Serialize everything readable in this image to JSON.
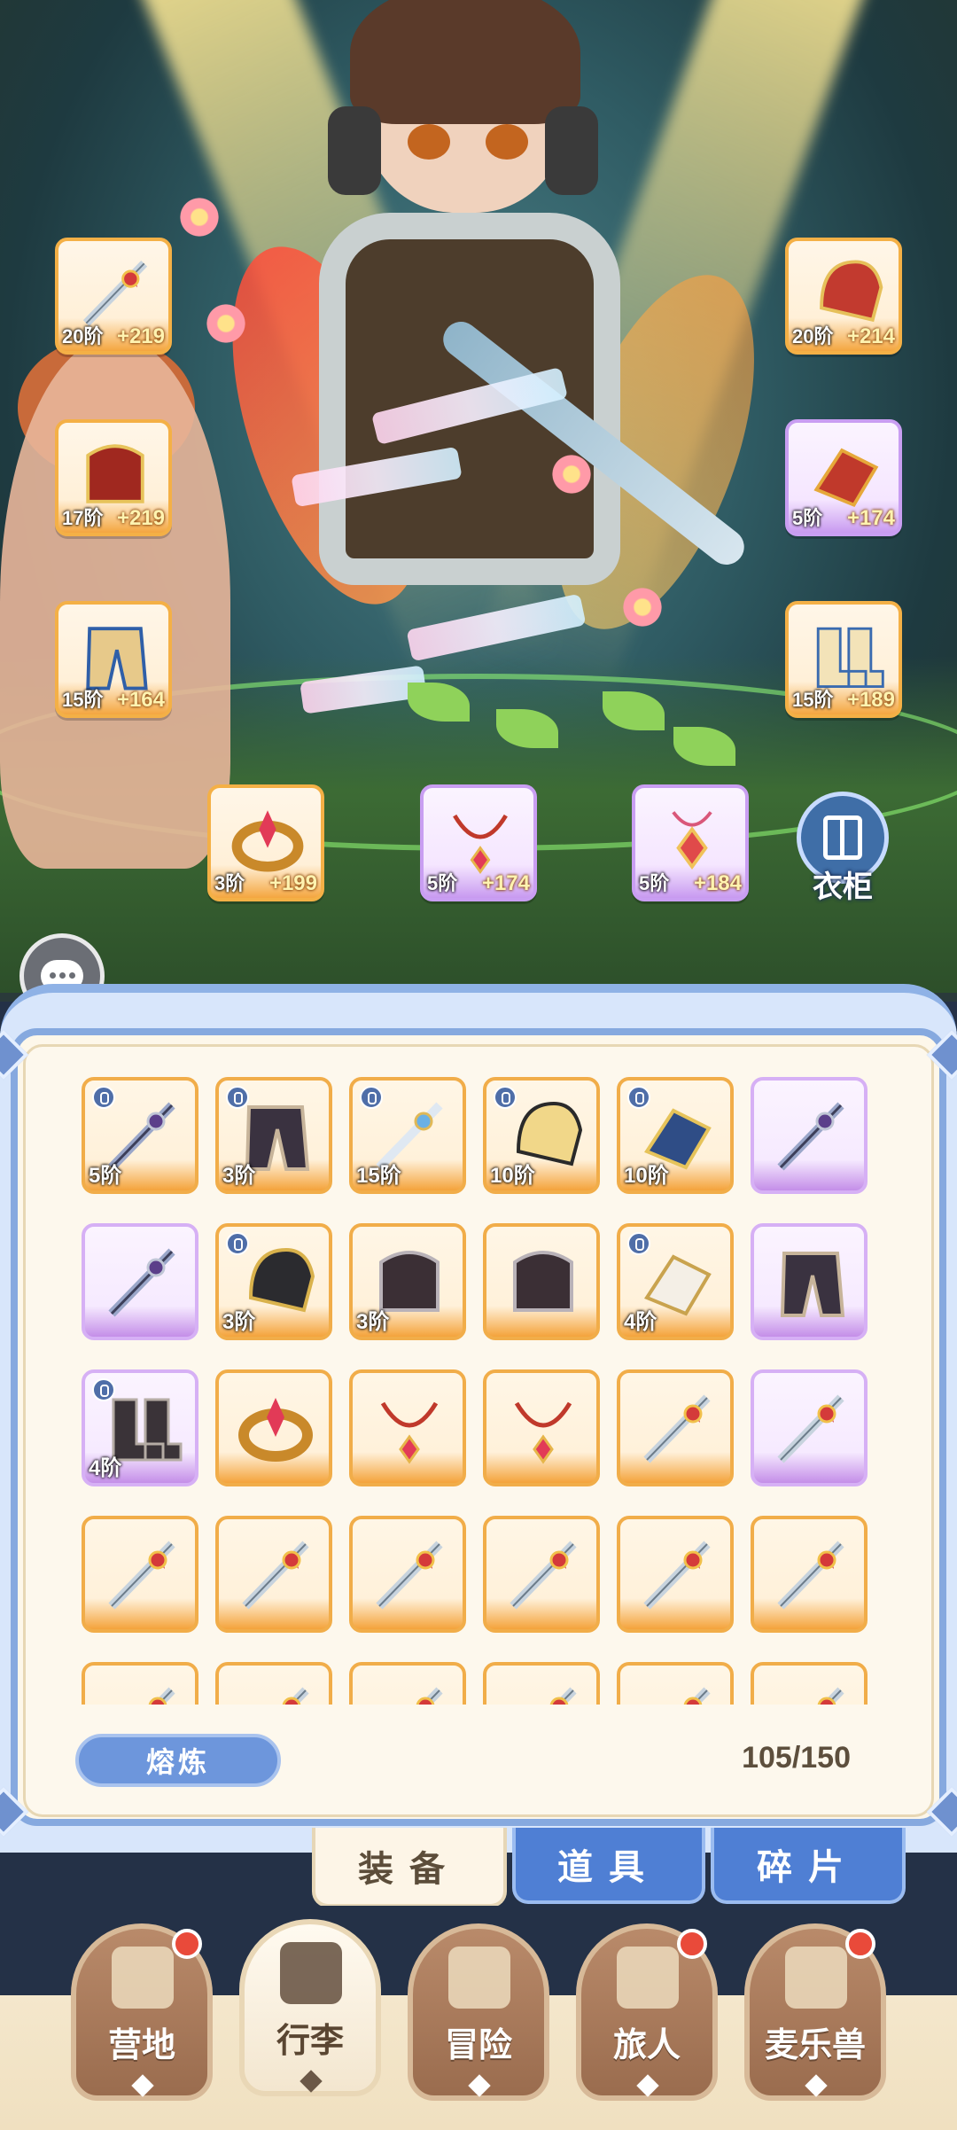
{
  "equipped": {
    "left": [
      {
        "slot": "weapon",
        "tier": "20阶",
        "score": "+219",
        "rarity": "orange",
        "icon": "sword"
      },
      {
        "slot": "armor",
        "tier": "17阶",
        "score": "+219",
        "rarity": "orange",
        "icon": "armor-red"
      },
      {
        "slot": "pants",
        "tier": "15阶",
        "score": "+164",
        "rarity": "orange",
        "icon": "pants"
      }
    ],
    "right": [
      {
        "slot": "helmet",
        "tier": "20阶",
        "score": "+214",
        "rarity": "orange",
        "icon": "helmet"
      },
      {
        "slot": "gloves",
        "tier": "5阶",
        "score": "+174",
        "rarity": "purple",
        "icon": "gauntlet"
      },
      {
        "slot": "boots",
        "tier": "15阶",
        "score": "+189",
        "rarity": "orange",
        "icon": "boots"
      }
    ],
    "accessories": [
      {
        "slot": "ring",
        "tier": "3阶",
        "score": "+199",
        "rarity": "orange",
        "icon": "ring"
      },
      {
        "slot": "necklace",
        "tier": "5阶",
        "score": "+174",
        "rarity": "purple",
        "icon": "necklace"
      },
      {
        "slot": "amulet",
        "tier": "5阶",
        "score": "+184",
        "rarity": "purple",
        "icon": "amulet"
      }
    ]
  },
  "wardrobe_label": "衣柜",
  "inventory": {
    "items": [
      {
        "icon": "sword-dark",
        "tier": "5阶",
        "locked": true,
        "rarity": "orange"
      },
      {
        "icon": "pants-dark",
        "tier": "3阶",
        "locked": true,
        "rarity": "orange"
      },
      {
        "icon": "sword-light",
        "tier": "15阶",
        "locked": true,
        "rarity": "orange"
      },
      {
        "icon": "helmet-gold",
        "tier": "10阶",
        "locked": true,
        "rarity": "orange"
      },
      {
        "icon": "gauntlet-gold",
        "tier": "10阶",
        "locked": true,
        "rarity": "orange"
      },
      {
        "icon": "sword-dark",
        "tier": "",
        "locked": false,
        "rarity": "purple"
      },
      {
        "icon": "sword-dark",
        "tier": "",
        "locked": false,
        "rarity": "purple"
      },
      {
        "icon": "helmet-dark",
        "tier": "3阶",
        "locked": true,
        "rarity": "orange"
      },
      {
        "icon": "armor-dark",
        "tier": "3阶",
        "locked": false,
        "rarity": "orange"
      },
      {
        "icon": "armor-dark",
        "tier": "",
        "locked": false,
        "rarity": "orange"
      },
      {
        "icon": "gauntlet-white",
        "tier": "4阶",
        "locked": true,
        "rarity": "orange"
      },
      {
        "icon": "pants-dark",
        "tier": "",
        "locked": false,
        "rarity": "purple"
      },
      {
        "icon": "boots-dark",
        "tier": "4阶",
        "locked": true,
        "rarity": "purple"
      },
      {
        "icon": "ring",
        "tier": "",
        "locked": false,
        "rarity": "orange"
      },
      {
        "icon": "necklace",
        "tier": "",
        "locked": false,
        "rarity": "orange"
      },
      {
        "icon": "necklace",
        "tier": "",
        "locked": false,
        "rarity": "orange"
      },
      {
        "icon": "sword",
        "tier": "",
        "locked": false,
        "rarity": "orange"
      },
      {
        "icon": "sword",
        "tier": "",
        "locked": false,
        "rarity": "purple"
      },
      {
        "icon": "sword",
        "tier": "",
        "locked": false,
        "rarity": "orange"
      },
      {
        "icon": "sword",
        "tier": "",
        "locked": false,
        "rarity": "orange"
      },
      {
        "icon": "sword",
        "tier": "",
        "locked": false,
        "rarity": "orange"
      },
      {
        "icon": "sword",
        "tier": "",
        "locked": false,
        "rarity": "orange"
      },
      {
        "icon": "sword",
        "tier": "",
        "locked": false,
        "rarity": "orange"
      },
      {
        "icon": "sword",
        "tier": "",
        "locked": false,
        "rarity": "orange"
      },
      {
        "icon": "sword",
        "tier": "",
        "locked": false,
        "rarity": "orange"
      },
      {
        "icon": "sword",
        "tier": "",
        "locked": false,
        "rarity": "orange"
      },
      {
        "icon": "sword",
        "tier": "",
        "locked": false,
        "rarity": "orange"
      },
      {
        "icon": "sword",
        "tier": "",
        "locked": false,
        "rarity": "orange"
      },
      {
        "icon": "sword",
        "tier": "",
        "locked": false,
        "rarity": "orange"
      },
      {
        "icon": "sword",
        "tier": "",
        "locked": false,
        "rarity": "orange"
      }
    ],
    "smelt_label": "熔炼",
    "capacity": "105/150"
  },
  "tabs": {
    "equipment": "装备",
    "items": "道具",
    "fragments": "碎片"
  },
  "nav": {
    "camp": "营地",
    "bag": "行李",
    "adventure": "冒险",
    "travelers": "旅人",
    "pets": "麦乐兽"
  },
  "colors": {
    "orange_rarity": "#f4a33b",
    "purple_rarity": "#c48ee8",
    "panel_border": "#86a9df",
    "tab_blue": "#4f7fd4",
    "badge_red": "#e94a3a"
  }
}
